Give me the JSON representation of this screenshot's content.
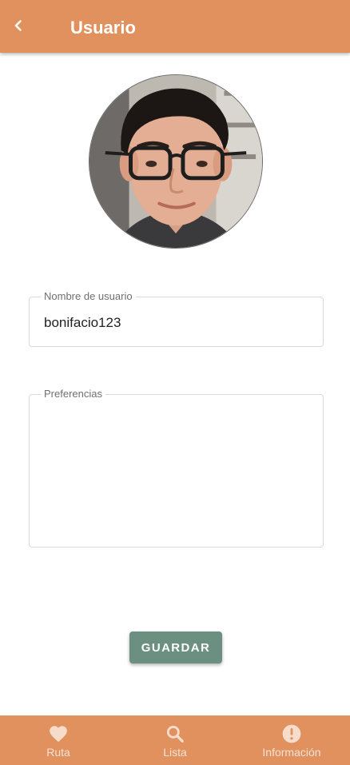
{
  "appbar": {
    "title": "Usuario",
    "back_icon": "chevron-left-icon"
  },
  "profile": {
    "avatar_icon": "user-photo"
  },
  "form": {
    "username": {
      "label": "Nombre de usuario",
      "value": "bonifacio123"
    },
    "preferences": {
      "label": "Preferencias",
      "value": ""
    },
    "save_label": "GUARDAR"
  },
  "bottom_nav": {
    "items": [
      {
        "label": "Ruta",
        "icon": "heart-icon"
      },
      {
        "label": "Lista",
        "icon": "search-icon"
      },
      {
        "label": "Información",
        "icon": "info-icon"
      }
    ]
  },
  "colors": {
    "primary": "#e0915e",
    "button": "#6b8f81",
    "nav_label": "#f4e2d6",
    "nav_icon": "#f6dccb"
  }
}
